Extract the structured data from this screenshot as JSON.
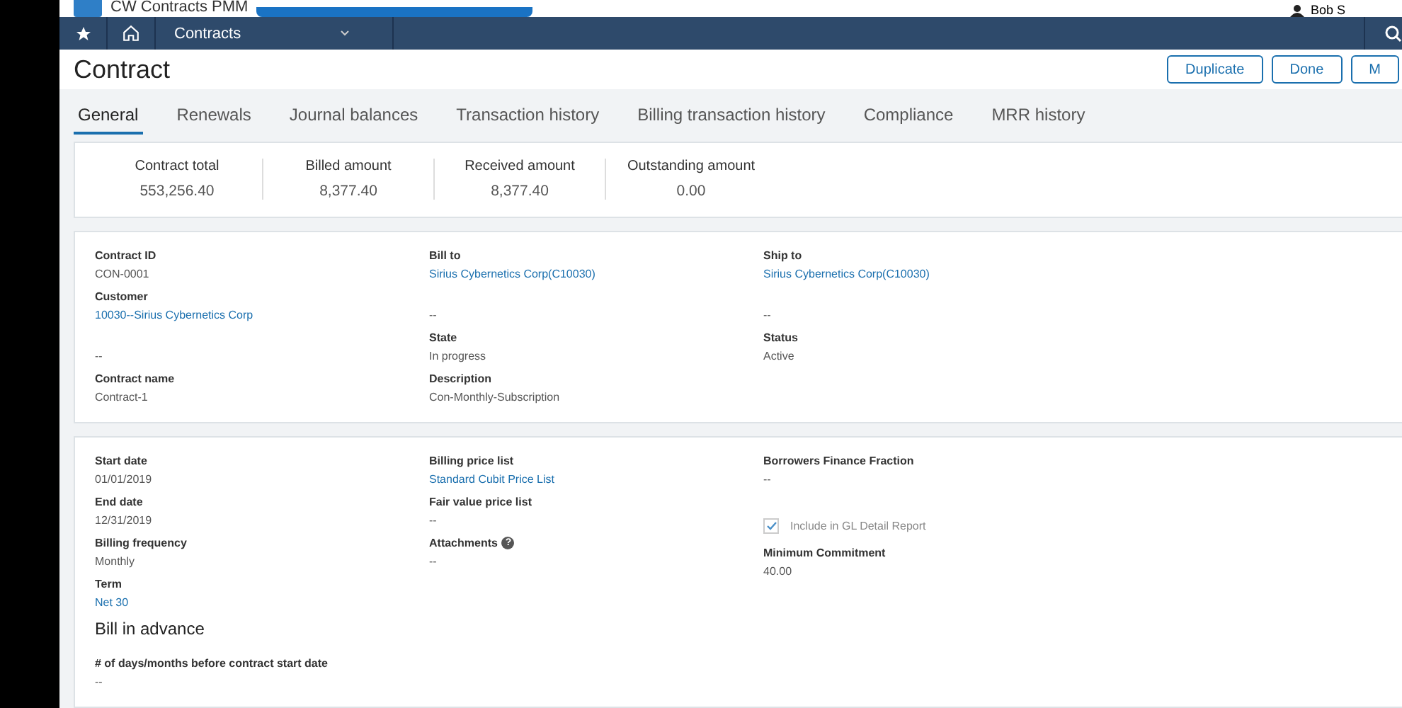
{
  "top_bar": {
    "app_name": "CW Contracts PMM",
    "user": "Bob S"
  },
  "nav": {
    "module": "Contracts"
  },
  "header": {
    "title": "Contract",
    "buttons": [
      "Duplicate",
      "Done",
      "M"
    ]
  },
  "tabs": [
    {
      "label": "General",
      "selected": true
    },
    {
      "label": "Renewals",
      "selected": false
    },
    {
      "label": "Journal balances",
      "selected": false
    },
    {
      "label": "Transaction history",
      "selected": false
    },
    {
      "label": "Billing transaction history",
      "selected": false
    },
    {
      "label": "Compliance",
      "selected": false
    },
    {
      "label": "MRR history",
      "selected": false
    }
  ],
  "summary": [
    {
      "label": "Contract total",
      "value": "553,256.40"
    },
    {
      "label": "Billed amount",
      "value": "8,377.40"
    },
    {
      "label": "Received amount",
      "value": "8,377.40"
    },
    {
      "label": "Outstanding amount",
      "value": "0.00"
    }
  ],
  "sections": [
    {
      "columns": [
        [
          {
            "kind": "text",
            "label": "Contract ID",
            "value": "CON-0001"
          },
          {
            "kind": "link",
            "label": "Customer",
            "value": "10030--Sirius Cybernetics Corp"
          },
          {
            "kind": "text",
            "value": "--"
          },
          {
            "kind": "text",
            "label": "Contract name",
            "value": "Contract-1"
          }
        ],
        [
          {
            "kind": "link",
            "label": "Bill to",
            "value": "Sirius Cybernetics Corp(C10030)"
          },
          {
            "kind": "text",
            "value": "--"
          },
          {
            "kind": "text",
            "label": "State",
            "value": "In progress"
          },
          {
            "kind": "text",
            "label": "Description",
            "value": "Con-Monthly-Subscription"
          }
        ],
        [
          {
            "kind": "link",
            "label": "Ship to",
            "value": "Sirius Cybernetics Corp(C10030)"
          },
          {
            "kind": "text",
            "value": "--"
          },
          {
            "kind": "text",
            "label": "Status",
            "value": "Active"
          }
        ]
      ]
    },
    {
      "columns": [
        [
          {
            "kind": "text",
            "label": "Start date",
            "value": "01/01/2019"
          },
          {
            "kind": "text",
            "label": "End date",
            "value": "12/31/2019"
          },
          {
            "kind": "text",
            "label": "Billing frequency",
            "value": "Monthly"
          },
          {
            "kind": "link",
            "label": "Term",
            "value": "Net 30"
          },
          {
            "kind": "heading",
            "label": "Bill in advance"
          },
          {
            "kind": "text",
            "label": "# of days/months before contract start date",
            "value": "--"
          }
        ],
        [
          {
            "kind": "link",
            "label": "Billing price list",
            "value": "Standard Cubit Price List"
          },
          {
            "kind": "text",
            "label": "Fair value price list",
            "value": "--"
          },
          {
            "kind": "text",
            "label": "Attachments",
            "value": "--",
            "help": "?"
          }
        ],
        [
          {
            "kind": "text",
            "label": "Borrowers Finance Fraction",
            "value": "--"
          },
          {
            "kind": "checkbox",
            "label": "Include in GL Detail Report",
            "checked": true
          },
          {
            "kind": "text",
            "label": "Minimum Commitment",
            "value": "40.00"
          }
        ]
      ]
    }
  ]
}
